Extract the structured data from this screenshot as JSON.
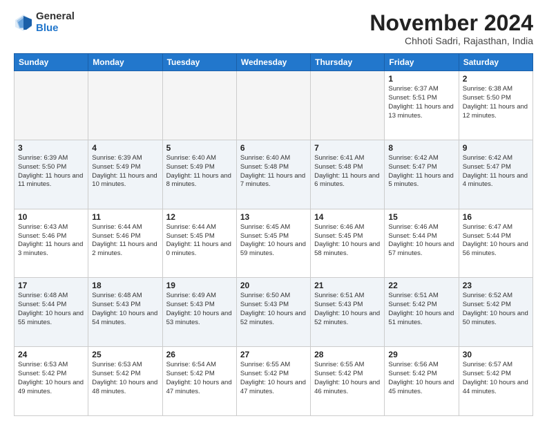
{
  "logo": {
    "general": "General",
    "blue": "Blue"
  },
  "header": {
    "month": "November 2024",
    "location": "Chhoti Sadri, Rajasthan, India"
  },
  "weekdays": [
    "Sunday",
    "Monday",
    "Tuesday",
    "Wednesday",
    "Thursday",
    "Friday",
    "Saturday"
  ],
  "weeks": [
    [
      {
        "day": "",
        "info": ""
      },
      {
        "day": "",
        "info": ""
      },
      {
        "day": "",
        "info": ""
      },
      {
        "day": "",
        "info": ""
      },
      {
        "day": "",
        "info": ""
      },
      {
        "day": "1",
        "info": "Sunrise: 6:37 AM\nSunset: 5:51 PM\nDaylight: 11 hours and 13 minutes."
      },
      {
        "day": "2",
        "info": "Sunrise: 6:38 AM\nSunset: 5:50 PM\nDaylight: 11 hours and 12 minutes."
      }
    ],
    [
      {
        "day": "3",
        "info": "Sunrise: 6:39 AM\nSunset: 5:50 PM\nDaylight: 11 hours and 11 minutes."
      },
      {
        "day": "4",
        "info": "Sunrise: 6:39 AM\nSunset: 5:49 PM\nDaylight: 11 hours and 10 minutes."
      },
      {
        "day": "5",
        "info": "Sunrise: 6:40 AM\nSunset: 5:49 PM\nDaylight: 11 hours and 8 minutes."
      },
      {
        "day": "6",
        "info": "Sunrise: 6:40 AM\nSunset: 5:48 PM\nDaylight: 11 hours and 7 minutes."
      },
      {
        "day": "7",
        "info": "Sunrise: 6:41 AM\nSunset: 5:48 PM\nDaylight: 11 hours and 6 minutes."
      },
      {
        "day": "8",
        "info": "Sunrise: 6:42 AM\nSunset: 5:47 PM\nDaylight: 11 hours and 5 minutes."
      },
      {
        "day": "9",
        "info": "Sunrise: 6:42 AM\nSunset: 5:47 PM\nDaylight: 11 hours and 4 minutes."
      }
    ],
    [
      {
        "day": "10",
        "info": "Sunrise: 6:43 AM\nSunset: 5:46 PM\nDaylight: 11 hours and 3 minutes."
      },
      {
        "day": "11",
        "info": "Sunrise: 6:44 AM\nSunset: 5:46 PM\nDaylight: 11 hours and 2 minutes."
      },
      {
        "day": "12",
        "info": "Sunrise: 6:44 AM\nSunset: 5:45 PM\nDaylight: 11 hours and 0 minutes."
      },
      {
        "day": "13",
        "info": "Sunrise: 6:45 AM\nSunset: 5:45 PM\nDaylight: 10 hours and 59 minutes."
      },
      {
        "day": "14",
        "info": "Sunrise: 6:46 AM\nSunset: 5:45 PM\nDaylight: 10 hours and 58 minutes."
      },
      {
        "day": "15",
        "info": "Sunrise: 6:46 AM\nSunset: 5:44 PM\nDaylight: 10 hours and 57 minutes."
      },
      {
        "day": "16",
        "info": "Sunrise: 6:47 AM\nSunset: 5:44 PM\nDaylight: 10 hours and 56 minutes."
      }
    ],
    [
      {
        "day": "17",
        "info": "Sunrise: 6:48 AM\nSunset: 5:44 PM\nDaylight: 10 hours and 55 minutes."
      },
      {
        "day": "18",
        "info": "Sunrise: 6:48 AM\nSunset: 5:43 PM\nDaylight: 10 hours and 54 minutes."
      },
      {
        "day": "19",
        "info": "Sunrise: 6:49 AM\nSunset: 5:43 PM\nDaylight: 10 hours and 53 minutes."
      },
      {
        "day": "20",
        "info": "Sunrise: 6:50 AM\nSunset: 5:43 PM\nDaylight: 10 hours and 52 minutes."
      },
      {
        "day": "21",
        "info": "Sunrise: 6:51 AM\nSunset: 5:43 PM\nDaylight: 10 hours and 52 minutes."
      },
      {
        "day": "22",
        "info": "Sunrise: 6:51 AM\nSunset: 5:42 PM\nDaylight: 10 hours and 51 minutes."
      },
      {
        "day": "23",
        "info": "Sunrise: 6:52 AM\nSunset: 5:42 PM\nDaylight: 10 hours and 50 minutes."
      }
    ],
    [
      {
        "day": "24",
        "info": "Sunrise: 6:53 AM\nSunset: 5:42 PM\nDaylight: 10 hours and 49 minutes."
      },
      {
        "day": "25",
        "info": "Sunrise: 6:53 AM\nSunset: 5:42 PM\nDaylight: 10 hours and 48 minutes."
      },
      {
        "day": "26",
        "info": "Sunrise: 6:54 AM\nSunset: 5:42 PM\nDaylight: 10 hours and 47 minutes."
      },
      {
        "day": "27",
        "info": "Sunrise: 6:55 AM\nSunset: 5:42 PM\nDaylight: 10 hours and 47 minutes."
      },
      {
        "day": "28",
        "info": "Sunrise: 6:55 AM\nSunset: 5:42 PM\nDaylight: 10 hours and 46 minutes."
      },
      {
        "day": "29",
        "info": "Sunrise: 6:56 AM\nSunset: 5:42 PM\nDaylight: 10 hours and 45 minutes."
      },
      {
        "day": "30",
        "info": "Sunrise: 6:57 AM\nSunset: 5:42 PM\nDaylight: 10 hours and 44 minutes."
      }
    ]
  ]
}
